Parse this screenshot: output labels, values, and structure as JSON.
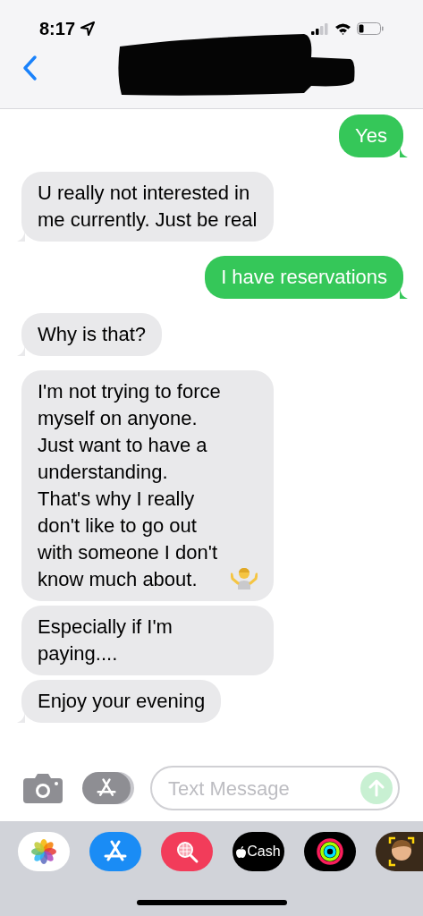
{
  "status_bar": {
    "time": "8:17"
  },
  "messages": [
    {
      "text": "Yes",
      "kind": "sent",
      "tail": true
    },
    {
      "text": "U really not interested in me currently. Just be real",
      "kind": "received",
      "tail": true
    },
    {
      "text": "I have reservations",
      "kind": "sent",
      "tail": true
    },
    {
      "text": "Why is that?",
      "kind": "received",
      "tail": true
    },
    {
      "text": "I'm not trying to force myself on anyone.  Just want to have a understanding.  That's why I really don't like to go out with someone I don't know much about.",
      "kind": "received",
      "tail": false,
      "shrug": true
    },
    {
      "text": "Especially if I'm paying....",
      "kind": "received",
      "tail": false
    },
    {
      "text": "Enjoy your evening",
      "kind": "received",
      "tail": true
    }
  ],
  "compose": {
    "placeholder": "Text Message"
  },
  "app_drawer": [
    {
      "kind": "photos"
    },
    {
      "kind": "appstore"
    },
    {
      "kind": "images"
    },
    {
      "kind": "cash",
      "label": "Cash"
    },
    {
      "kind": "activity"
    },
    {
      "kind": "memoji"
    }
  ]
}
